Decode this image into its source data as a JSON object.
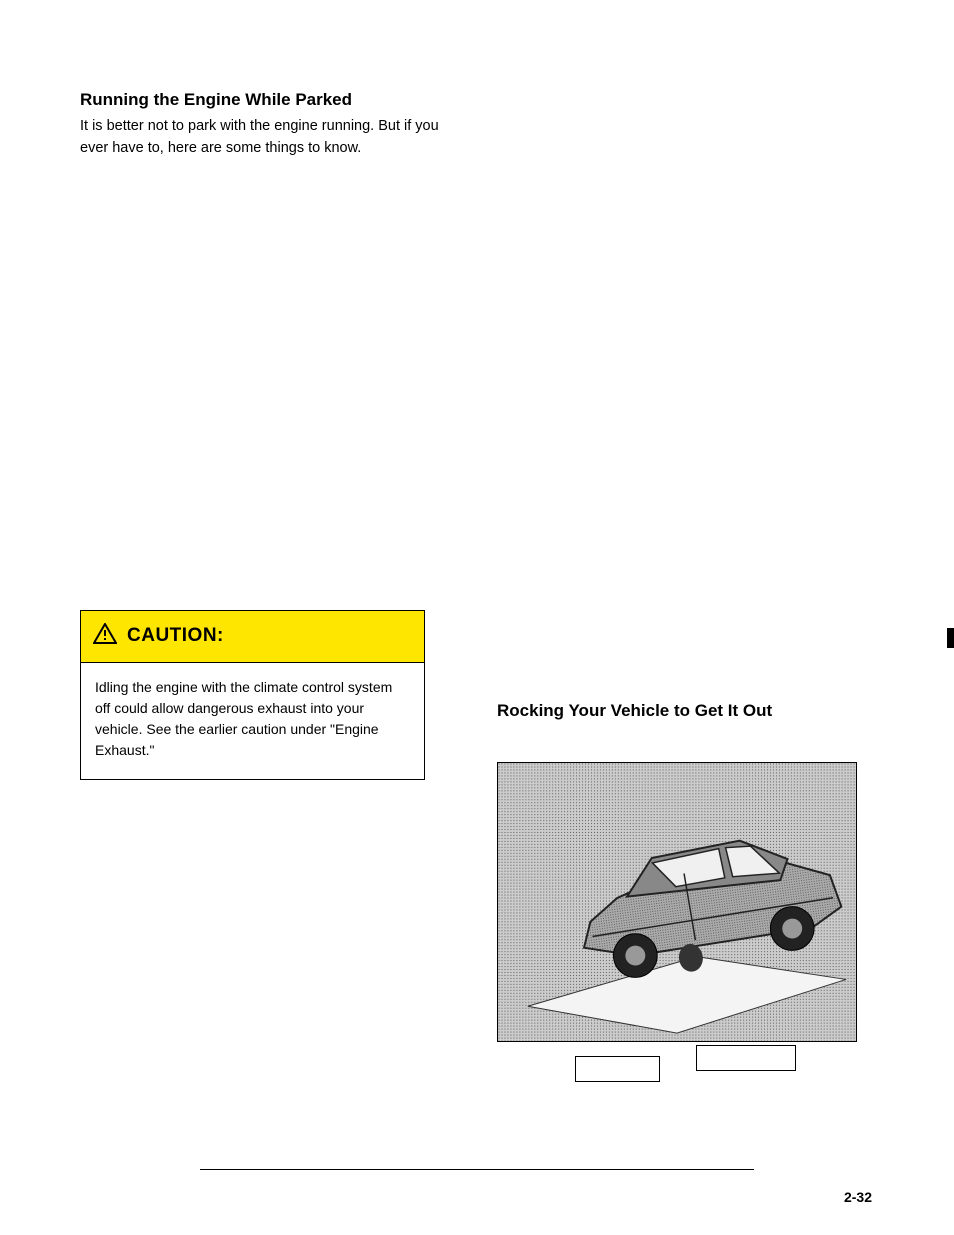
{
  "left_column": {
    "heading": "Running the Engine While Parked",
    "para1": "It is better not to park with the engine running. But if you ever have to, here are some things to know.",
    "caution": {
      "title": "CAUTION:",
      "body": "Idling the engine with the climate control system off could allow dangerous exhaust into your vehicle. See the earlier caution under \"Engine Exhaust.\"",
      "icon_name": "warning-triangle-icon"
    }
  },
  "right_column": {
    "rocking_heading": "Rocking Your Vehicle to Get It Out",
    "illustration_alt": "car-on-incline-illustration"
  },
  "page_number": "2-32"
}
